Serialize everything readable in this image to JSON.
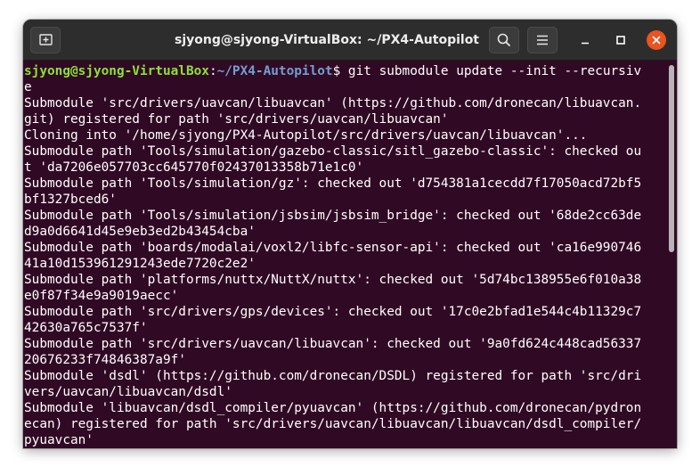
{
  "window": {
    "title": "sjyong@sjyong-VirtualBox: ~/PX4-Autopilot",
    "buttons": {
      "new_tab": "new-tab-icon",
      "search": "search-icon",
      "menu": "hamburger-menu-icon",
      "minimize": "minimize-icon",
      "maximize": "maximize-icon",
      "close": "close-icon"
    }
  },
  "colors": {
    "terminal_bg": "#300a24",
    "titlebar_bg": "#2d2d2d",
    "prompt_user": "#8ae234",
    "prompt_path": "#729fcf",
    "close_button": "#e95420",
    "text": "#ffffff"
  },
  "terminal": {
    "prompt": {
      "user_host": "sjyong@sjyong-VirtualBox",
      "separator": ":",
      "path": "~/PX4-Autopilot",
      "dollar": "$"
    },
    "command_part1": " git submodule update --init --recursiv",
    "command_part2": "e",
    "output": [
      "Submodule 'src/drivers/uavcan/libuavcan' (https://github.com/dronecan/libuavcan.",
      "git) registered for path 'src/drivers/uavcan/libuavcan'",
      "Cloning into '/home/sjyong/PX4-Autopilot/src/drivers/uavcan/libuavcan'...",
      "Submodule path 'Tools/simulation/gazebo-classic/sitl_gazebo-classic': checked ou",
      "t 'da7206e057703cc645770f02437013358b71e1c0'",
      "Submodule path 'Tools/simulation/gz': checked out 'd754381a1cecdd7f17050acd72bf5",
      "bf1327bced6'",
      "Submodule path 'Tools/simulation/jsbsim/jsbsim_bridge': checked out '68de2cc63de",
      "d9a0d6641d45e9eb3ed2b43454cba'",
      "Submodule path 'boards/modalai/voxl2/libfc-sensor-api': checked out 'ca16e990746",
      "41a10d153961291243ede7720c2e2'",
      "Submodule path 'platforms/nuttx/NuttX/nuttx': checked out '5d74bc138955e6f010a38",
      "e0f87f34e9a9019aecc'",
      "Submodule path 'src/drivers/gps/devices': checked out '17c0e2bfad1e544c4b11329c7",
      "42630a765c7537f'",
      "Submodule path 'src/drivers/uavcan/libuavcan': checked out '9a0fd624c448cad56337",
      "20676233f74846387a9f'",
      "Submodule 'dsdl' (https://github.com/dronecan/DSDL) registered for path 'src/dri",
      "vers/uavcan/libuavcan/dsdl'",
      "Submodule 'libuavcan/dsdl_compiler/pyuavcan' (https://github.com/dronecan/pydron",
      "ecan) registered for path 'src/drivers/uavcan/libuavcan/libuavcan/dsdl_compiler/",
      "pyuavcan'"
    ]
  }
}
